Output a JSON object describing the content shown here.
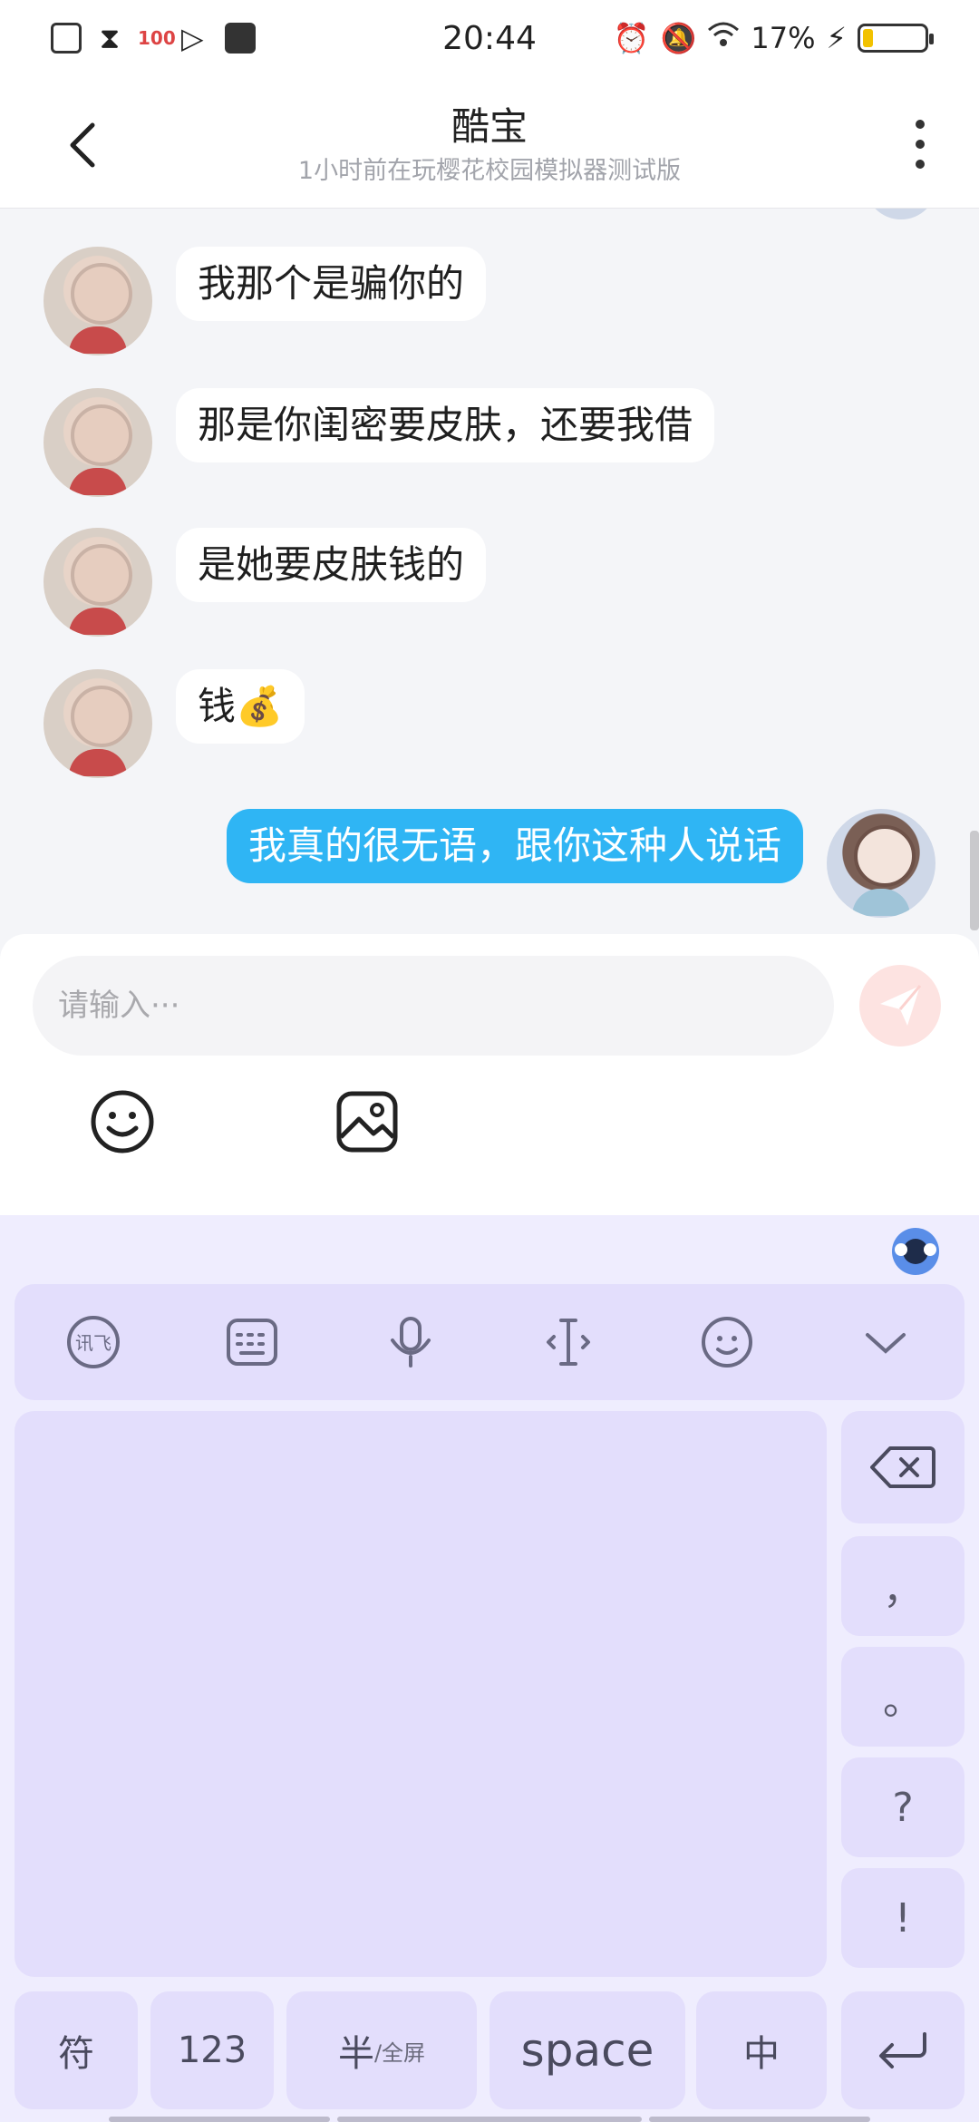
{
  "status_bar": {
    "time": "20:44",
    "battery_percent_text": "17%",
    "battery_level": 0.17,
    "left_icons": [
      "sim-icon",
      "hourglass-icon",
      "app-badge-icon",
      "play-icon",
      "mail-icon"
    ],
    "right_icons": [
      "alarm-icon",
      "mute-icon",
      "wifi-icon",
      "charging-icon",
      "battery-icon"
    ]
  },
  "header": {
    "title": "酷宝",
    "subtitle": "1小时前在玩樱花校园模拟器测试版"
  },
  "messages": [
    {
      "sender": "other",
      "text": "我那个是骗你的"
    },
    {
      "sender": "other",
      "text": "那是你闺密要皮肤，还要我借"
    },
    {
      "sender": "other",
      "text": "是她要皮肤钱的"
    },
    {
      "sender": "other",
      "text": "钱💰"
    },
    {
      "sender": "me",
      "text": "我真的很无语，跟你这种人说话"
    }
  ],
  "composer": {
    "placeholder": "请输入···"
  },
  "keyboard": {
    "side_keys": [
      "，",
      "。",
      "?",
      "!"
    ],
    "bottom_keys": {
      "symbols": "符",
      "numbers": "123",
      "half": "半",
      "full": "/全屏",
      "space": "space",
      "lang": "中"
    },
    "colors": {
      "accent": "#2fb5f4",
      "keyboard_bg": "#efedfe",
      "key_bg": "#e3defc"
    }
  }
}
